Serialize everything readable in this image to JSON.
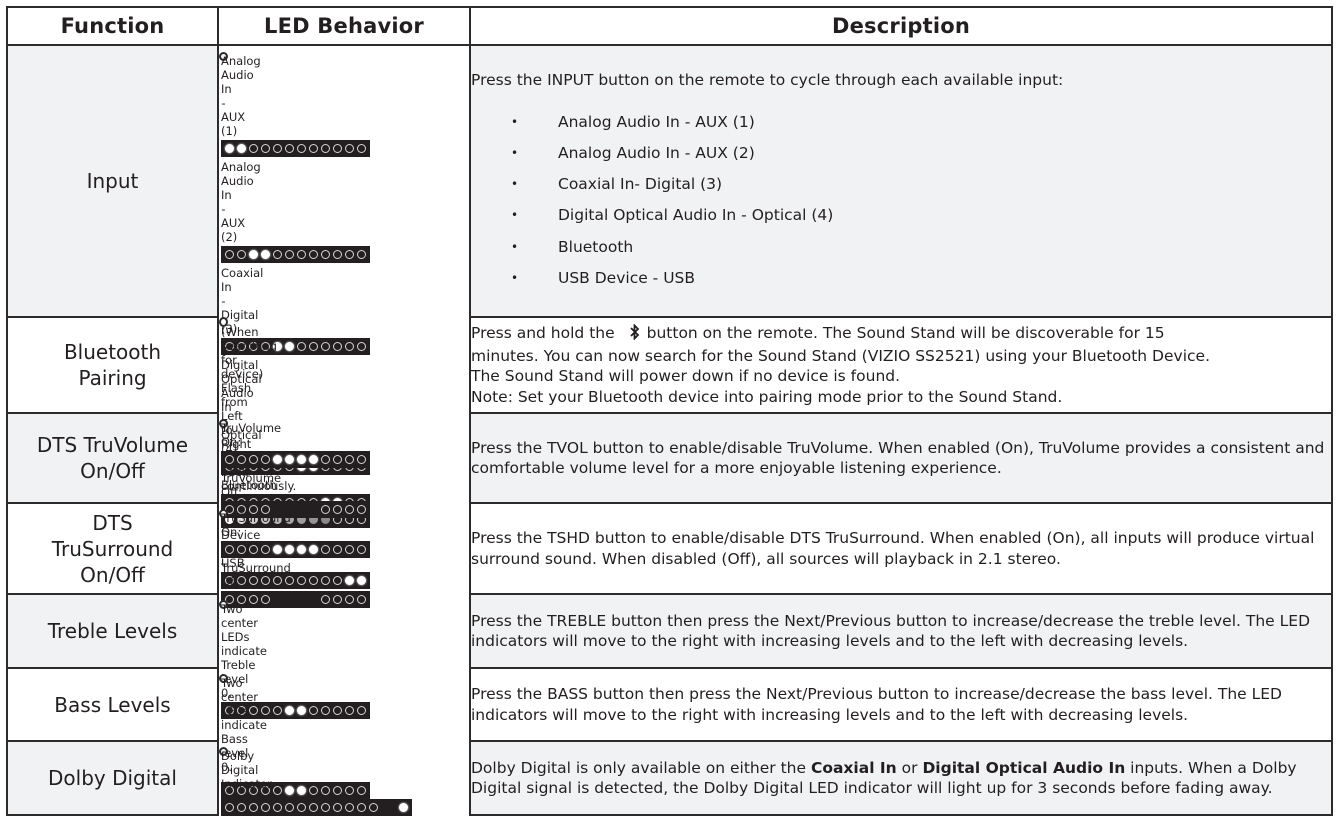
{
  "headers": {
    "function": "Function",
    "led_behavior": "LED Behavior",
    "description": "Description"
  },
  "colors": {
    "border": "#2b2b2b",
    "row_shade": "#f1f2f4",
    "led_bar_bg": "#231f20",
    "led_on": "#ffffff"
  },
  "rows": [
    {
      "function": "Input",
      "leds": [
        {
          "caption": "Analog Audio In - AUX (1)",
          "pattern": "110000000000"
        },
        {
          "caption": "Analog Audio In - AUX (2)",
          "pattern": "001100000000"
        },
        {
          "caption": "Coaxial In - Digital (3)",
          "pattern": "000011000000"
        },
        {
          "caption": "Digital Optical Audio In - Optical (4)",
          "pattern": "000000110000"
        },
        {
          "caption": "Bluetooth",
          "pattern": "000000001100"
        },
        {
          "caption": "USB Device - USB",
          "pattern": "000000000011"
        }
      ],
      "description_intro": "Press the INPUT button on the remote to cycle through each available input:",
      "bullet": "•",
      "inputs": [
        "Analog Audio In - AUX (1)",
        "Analog Audio In - AUX (2)",
        "Coaxial In- Digital (3)",
        "Digital Optical Audio In - Optical (4)",
        "Bluetooth",
        "USB Device - USB"
      ]
    },
    {
      "function_line1": "Bluetooth",
      "function_line2": "Pairing",
      "led_caption_line1": "(When searching for device)",
      "led_caption_line2": "Flash from Left to Right",
      "led_caption_line3": "and back continuously.",
      "led_pattern": "flash-fade",
      "led_fade_levels": [
        1.0,
        0.85,
        0.75,
        0.7,
        0.65,
        0.55,
        0.5,
        0.45,
        0.4,
        0,
        0,
        0
      ],
      "desc_part1": "Press and hold the",
      "icon": "bluetooth-icon",
      "desc_part2": "button on the remote. The Sound Stand will be discoverable for 15",
      "desc_line2": "minutes.  You can now search for the Sound Stand (VIZIO SS2521) using your Bluetooth Device.",
      "desc_line3": "The Sound Stand will power down if no device is found.",
      "desc_line4": "Note: Set your Bluetooth device into pairing mode prior to the Sound Stand."
    },
    {
      "function_line1": "DTS TruVolume",
      "function_line2": "On/Off",
      "led_on_caption": "TruVolume On:",
      "led_on_pattern": "000011110000",
      "led_off_caption": "TruVolume Off:",
      "led_off_pattern": "0000xxxx0000",
      "description": "Press the TVOL button to enable/disable TruVolume. When enabled (On), TruVolume provides a consistent and comfortable volume level for a more enjoyable listening experience."
    },
    {
      "function_line1": "DTS",
      "function_line2": "TruSurround",
      "function_line3": "On/Off",
      "led_on_caption": "TruSurround On:",
      "led_on_pattern": "000011110000",
      "led_off_caption": "TruSurround Off:",
      "led_off_pattern": "0000xxxx0000",
      "description": "Press the TSHD button to enable/disable DTS TruSurround. When enabled (On), all inputs will produce virtual surround sound. When disabled (Off), all sources will playback in 2.1 stereo."
    },
    {
      "function": "Treble Levels",
      "led_caption_line1": "Two center LEDs indicate",
      "led_caption_line2": "Treble level 0.",
      "led_pattern": "000001100000",
      "description": "Press the TREBLE button then press the Next/Previous button to increase/decrease the treble level. The LED indicators will move to the right with increasing levels and to the left with decreasing levels."
    },
    {
      "function": "Bass Levels",
      "led_caption_line1": "Two center LEDs indicate",
      "led_caption_line2": "Bass level 0.",
      "led_pattern": "000001100000",
      "description": "Press the BASS button then press the Next/Previous button to increase/decrease the bass level. The LED indicators will move to the right with increasing levels and to the left with decreasing levels."
    },
    {
      "function": "Dolby Digital",
      "led_caption": "Dolby Digital Indicator.",
      "led_pattern": "0000000000000|1",
      "desc_part1": "Dolby Digital is only available on either the ",
      "desc_bold1": "Coaxial In",
      "desc_part2": " or ",
      "desc_bold2": "Digital Optical Audio In",
      "desc_part3": " inputs. When a Dolby Digital signal is detected, the Dolby Digital LED indicator will light up for 3 seconds before fading away."
    }
  ]
}
